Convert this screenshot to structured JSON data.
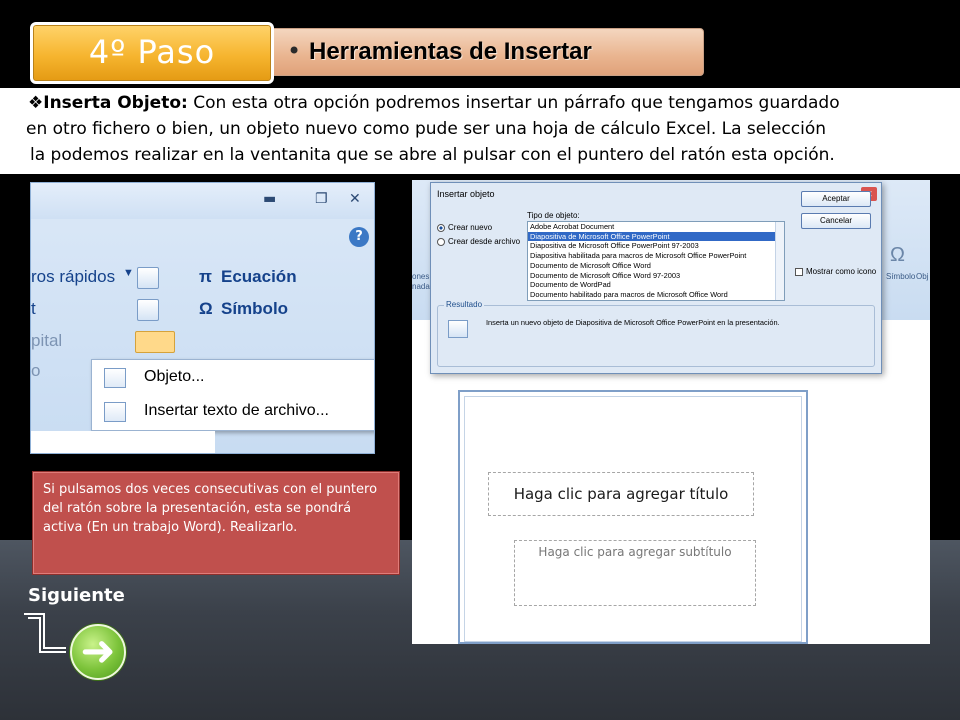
{
  "header": {
    "step": "4º Paso",
    "title": "Herramientas de Insertar"
  },
  "intro": {
    "term": "Inserta  Objeto:",
    "line1_rest": " Con esta otra opción podremos insertar un párrafo que tengamos guardado",
    "line2": "en otro fichero o bien, un objeto nuevo como pude ser una hoja de cálculo Excel. La selección",
    "line3": "la podemos realizar en la ventanita que se abre al pulsar con el puntero del ratón esta opción."
  },
  "ribbon": {
    "labels": [
      "ros rápidos",
      "t",
      "pital",
      "o"
    ],
    "equation": "Ecuación",
    "symbol": "Símbolo",
    "menu": [
      {
        "label": "Objeto..."
      },
      {
        "label": "Insertar texto de archivo..."
      }
    ]
  },
  "dialog": {
    "title": "Insertar objeto",
    "radio_new": "Crear nuevo",
    "radio_file": "Crear desde archivo",
    "type_label": "Tipo de objeto:",
    "types": [
      "Adobe Acrobat Document",
      "Diapositiva de Microsoft Office PowerPoint",
      "Diapositiva de Microsoft Office PowerPoint 97-2003",
      "Diapositiva habilitada para macros de Microsoft Office PowerPoint",
      "Documento de Microsoft Office Word",
      "Documento de Microsoft Office Word 97-2003",
      "Documento de WordPad",
      "Documento habilitado para macros de Microsoft Office Word"
    ],
    "selected_index": 1,
    "ok": "Aceptar",
    "cancel": "Cancelar",
    "show_as_icon": "Mostrar como icono",
    "result_label": "Resultado",
    "result_text": "Inserta un nuevo objeto de Diapositiva de Microsoft Office PowerPoint en la presentación.",
    "side_labels": [
      "Símbolo",
      "Obj"
    ],
    "left_labels": [
      "ones",
      "nadas"
    ]
  },
  "slide": {
    "title_placeholder": "Haga clic para agregar título",
    "subtitle_placeholder": "Haga clic para agregar subtítulo"
  },
  "note": {
    "text": "Si pulsamos dos veces consecutivas con el puntero del ratón sobre la  presentación, esta se pondrá activa (En un trabajo Word). Realizarlo."
  },
  "navigation": {
    "next_label": "Siguiente",
    "next_icon": "arrow-right-icon"
  }
}
